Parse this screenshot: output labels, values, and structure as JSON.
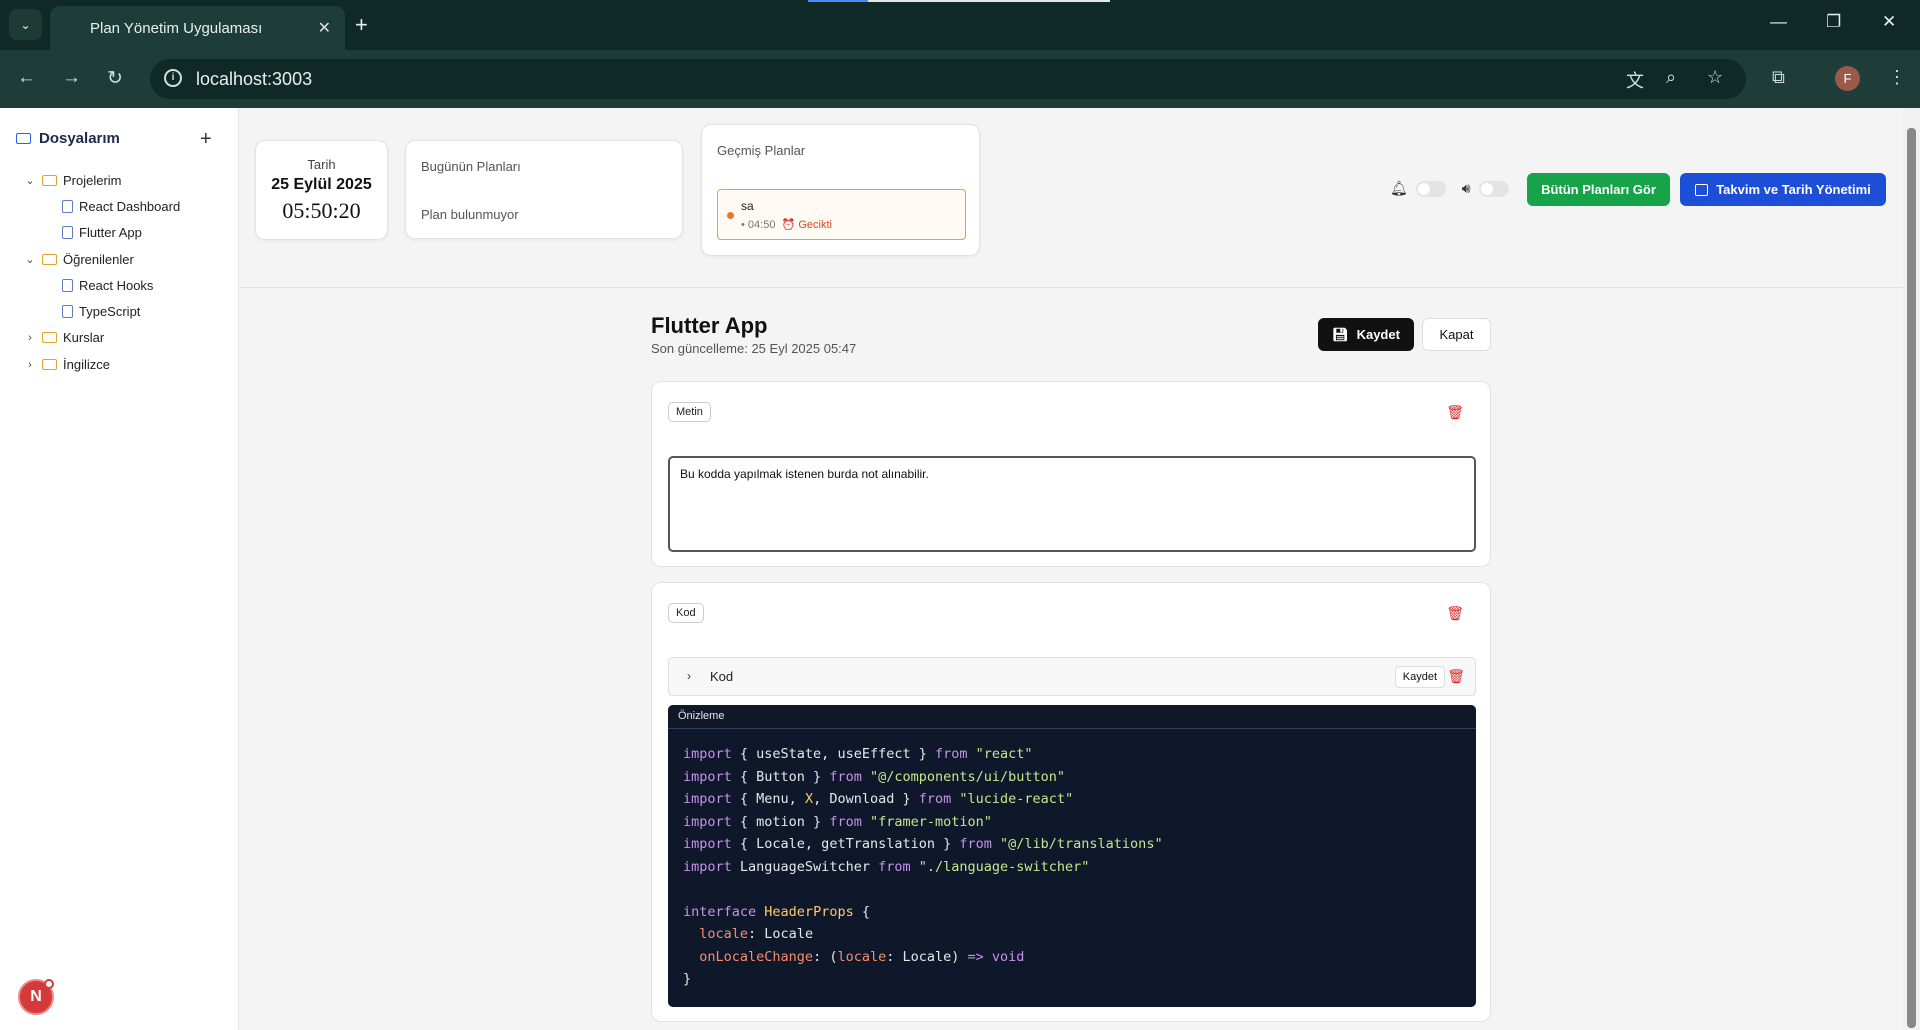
{
  "browser": {
    "tab_title": "Plan Yönetim Uygulaması",
    "url": "localhost:3003",
    "avatar": "F"
  },
  "sidebar": {
    "title": "Dosyalarım",
    "tree": [
      {
        "label": "Projelerim",
        "type": "folder",
        "expanded": true
      },
      {
        "label": "React Dashboard",
        "type": "file"
      },
      {
        "label": "Flutter App",
        "type": "file"
      },
      {
        "label": "Öğrenilenler",
        "type": "folder",
        "expanded": true
      },
      {
        "label": "React Hooks",
        "type": "file"
      },
      {
        "label": "TypeScript",
        "type": "file"
      },
      {
        "label": "Kurslar",
        "type": "folder",
        "expanded": false
      },
      {
        "label": "İngilizce",
        "type": "folder",
        "expanded": false
      }
    ],
    "badge": "N"
  },
  "header": {
    "date_label": "Tarih",
    "date": "25 Eylül 2025",
    "time": "05:50:20",
    "today_label": "Bugünün Planları",
    "today_empty": "Plan bulunmuyor",
    "past_label": "Geçmiş Planlar",
    "past_item": {
      "name": "sa",
      "time": "• 04:50",
      "status": "Gecikti"
    },
    "all_plans_btn": "Bütün Planları Gör",
    "calendar_btn": "Takvim ve Tarih Yönetimi"
  },
  "doc": {
    "title": "Flutter App",
    "updated": "Son güncelleme: 25 Eyl 2025 05:47",
    "save": "Kaydet",
    "close": "Kapat",
    "text_block": {
      "chip": "Metin",
      "value": "Bu kodda yapılmak istenen burda not alınabilir."
    },
    "code_block": {
      "chip": "Kod",
      "header": "Kod",
      "save": "Kaydet",
      "preview": "Önizleme"
    }
  },
  "colors": {
    "green": "#16a34a",
    "blue": "#1d4ed8",
    "danger": "#dc2626",
    "code_bg": "#0f172a"
  }
}
